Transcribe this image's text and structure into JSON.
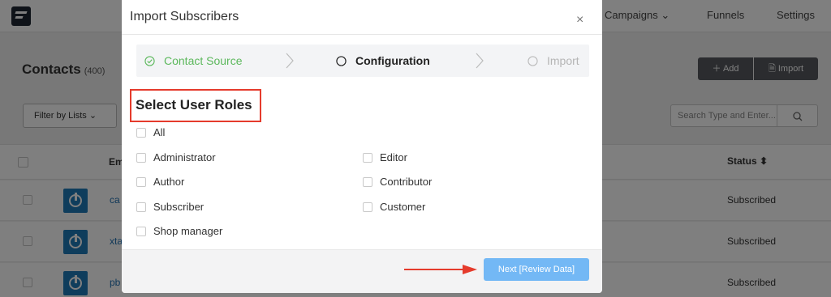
{
  "nav": {
    "campaigns_label": "Campaigns",
    "funnels_label": "Funnels",
    "settings_label": "Settings"
  },
  "page": {
    "title": "Contacts",
    "count": "(400)",
    "add_label": "Add",
    "import_label": "Import",
    "filter_label": "Filter by Lists",
    "search_placeholder": "Search Type and Enter..."
  },
  "table": {
    "headers": {
      "email": "Em",
      "status": "Status"
    },
    "rows": [
      {
        "email": "ca",
        "status": "Subscribed"
      },
      {
        "email": "xta",
        "status": "Subscribed"
      },
      {
        "email": "pb",
        "status": "Subscribed"
      }
    ]
  },
  "modal": {
    "title": "Import Subscribers",
    "close_glyph": "×",
    "steps": [
      {
        "label": "Contact Source",
        "state": "done"
      },
      {
        "label": "Configuration",
        "state": "active"
      },
      {
        "label": "Import",
        "state": "pending"
      }
    ],
    "section_title": "Select User Roles",
    "roles": {
      "all": "All",
      "administrator": "Administrator",
      "editor": "Editor",
      "author": "Author",
      "contributor": "Contributor",
      "subscriber": "Subscriber",
      "customer": "Customer",
      "shop_manager": "Shop manager"
    },
    "next_label": "Next [Review Data]"
  },
  "colors": {
    "success": "#5cb85c",
    "accent": "#73b8f5",
    "highlight": "#e53b2c"
  }
}
